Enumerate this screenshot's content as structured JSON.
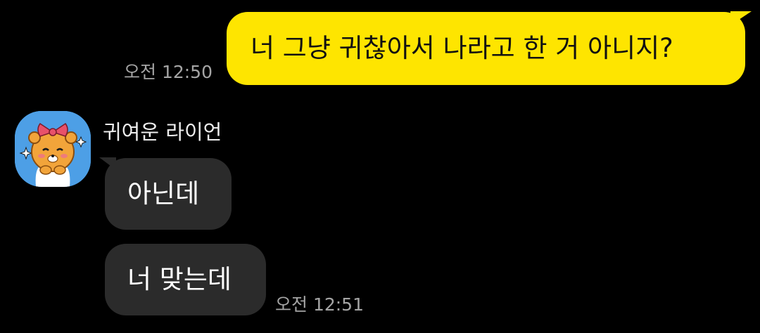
{
  "messages": [
    {
      "direction": "outgoing",
      "text": "너 그냥 귀찮아서 나라고 한 거 아니지?",
      "time": "오전 12:50"
    },
    {
      "direction": "incoming",
      "sender": "귀여운 라이언",
      "text": "아닌데"
    },
    {
      "direction": "incoming",
      "text": "너 맞는데",
      "time": "오전 12:51"
    }
  ],
  "colors": {
    "background": "#000000",
    "outgoing_bubble": "#fee500",
    "incoming_bubble": "#2b2b2b",
    "timestamp": "#a5a5a5"
  },
  "icons": {
    "avatar": "ryan-character-avatar"
  }
}
